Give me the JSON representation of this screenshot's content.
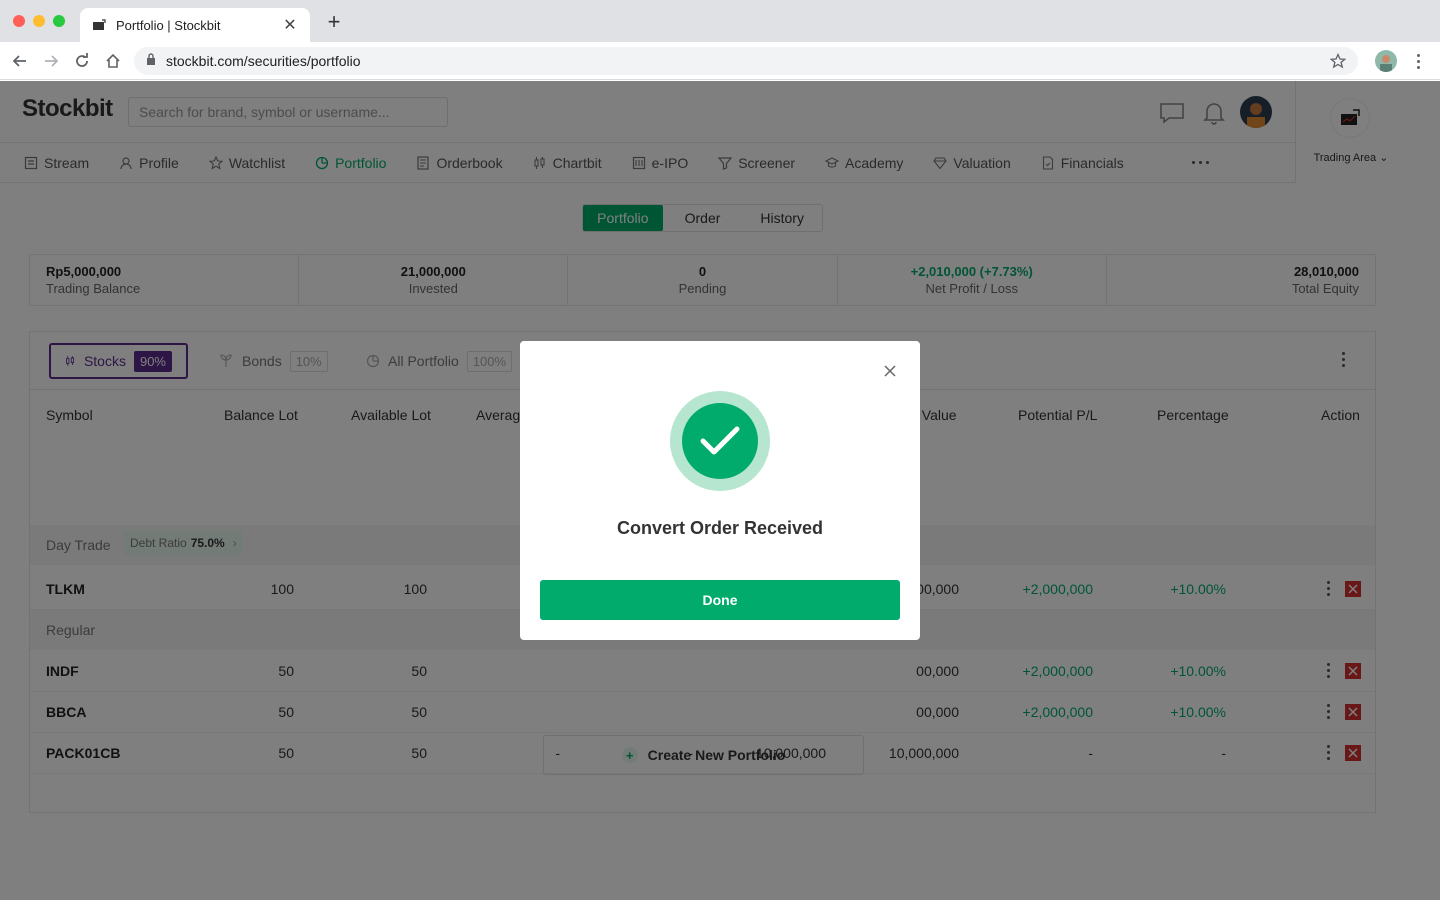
{
  "browser": {
    "tab_title": "Portfolio | Stockbit",
    "url": "stockbit.com/securities/portfolio"
  },
  "app": {
    "logo": "Stockbit",
    "search_placeholder": "Search for brand, symbol or username...",
    "trading_area_label": "Trading Area",
    "nav": [
      {
        "label": "Stream",
        "icon": "stream-icon"
      },
      {
        "label": "Profile",
        "icon": "user-icon"
      },
      {
        "label": "Watchlist",
        "icon": "star-icon"
      },
      {
        "label": "Portfolio",
        "icon": "pie-icon",
        "active": true
      },
      {
        "label": "Orderbook",
        "icon": "book-icon"
      },
      {
        "label": "Chartbit",
        "icon": "candlestick-icon"
      },
      {
        "label": "e-IPO",
        "icon": "ipo-icon"
      },
      {
        "label": "Screener",
        "icon": "filter-icon"
      },
      {
        "label": "Academy",
        "icon": "academy-icon"
      },
      {
        "label": "Valuation",
        "icon": "diamond-icon"
      },
      {
        "label": "Financials",
        "icon": "document-icon"
      }
    ]
  },
  "tabs": [
    "Portfolio",
    "Order",
    "History"
  ],
  "summary": {
    "trading_balance_value": "Rp5,000,000",
    "trading_balance_label": "Trading Balance",
    "invested_value": "21,000,000",
    "invested_label": "Invested",
    "pending_value": "0",
    "pending_label": "Pending",
    "net_profit_value": "+2,010,000 (+7.73%)",
    "net_profit_label": "Net Profit / Loss",
    "total_equity_value": "28,010,000",
    "total_equity_label": "Total Equity"
  },
  "categories": [
    {
      "label": "Stocks",
      "pct": "90%"
    },
    {
      "label": "Bonds",
      "pct": "10%"
    },
    {
      "label": "All Portfolio",
      "pct": "100%"
    }
  ],
  "table": {
    "headers": {
      "symbol": "Symbol",
      "balance_lot": "Balance Lot",
      "available_lot": "Available Lot",
      "average_partial": "Averag",
      "value_partial": "t Value",
      "potential_pl": "Potential P/L",
      "percentage": "Percentage",
      "action": "Action"
    },
    "day_trade": {
      "label": "Day Trade",
      "debt_ratio_label": "Debt Ratio",
      "debt_ratio_value": "75.0%"
    },
    "regular_label": "Regular",
    "rows": [
      {
        "symbol": "TLKM",
        "balance": "100",
        "available": "100",
        "avg": "",
        "last": "",
        "invested": "",
        "value": "00,000",
        "pl": "+2,000,000",
        "pct": "+10.00%"
      },
      {
        "symbol": "INDF",
        "balance": "50",
        "available": "50",
        "avg": "",
        "last": "",
        "invested": "",
        "value": "00,000",
        "pl": "+2,000,000",
        "pct": "+10.00%"
      },
      {
        "symbol": "BBCA",
        "balance": "50",
        "available": "50",
        "avg": "",
        "last": "",
        "invested": "",
        "value": "00,000",
        "pl": "+2,000,000",
        "pct": "+10.00%"
      },
      {
        "symbol": "PACK01CB",
        "balance": "50",
        "available": "50",
        "avg": "-",
        "last": "-",
        "invested": "10,000,000",
        "value": "10,000,000",
        "pl": "-",
        "pct": "-"
      }
    ]
  },
  "create_portfolio_label": "Create New Portfolio",
  "modal": {
    "title": "Convert Order Received",
    "done_label": "Done"
  },
  "colors": {
    "brand_green": "#00ab6b",
    "stocks_purple": "#5b2b8c",
    "danger_red": "#d32f2f"
  }
}
